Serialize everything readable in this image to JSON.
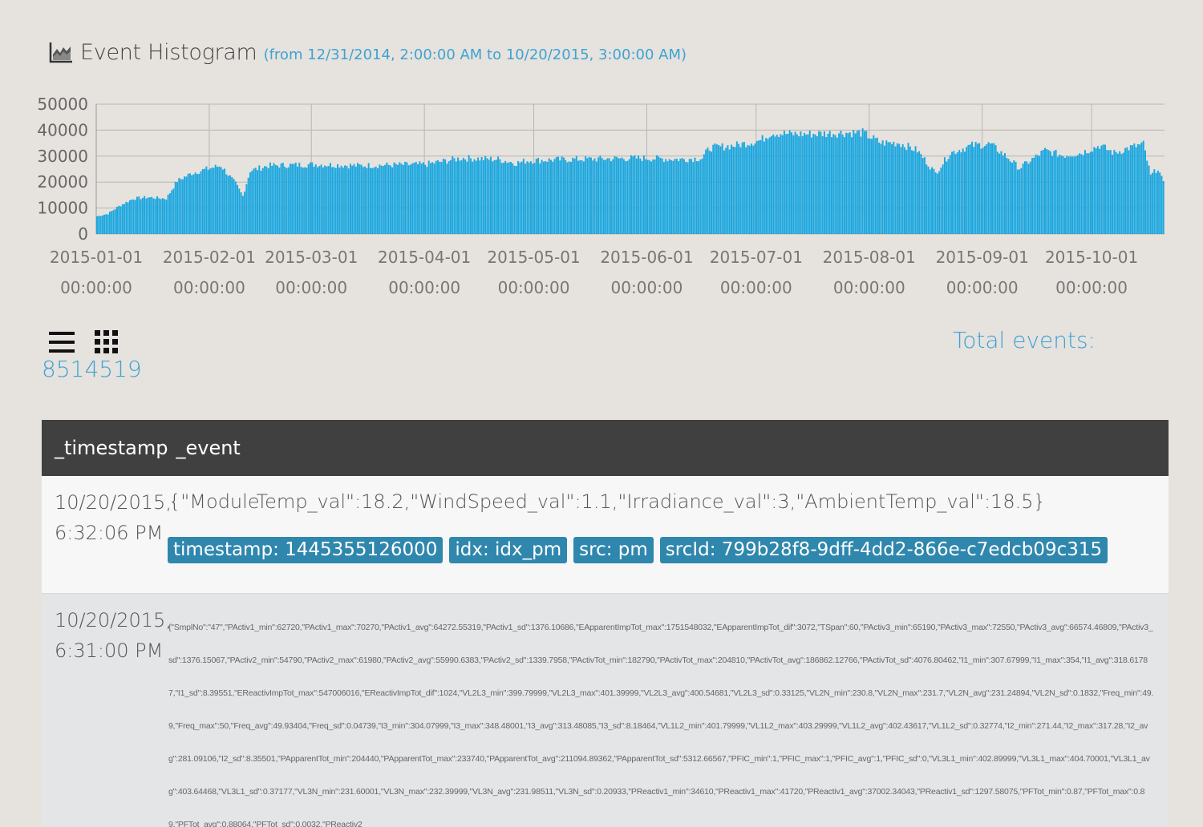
{
  "header": {
    "title": "Event Histogram",
    "range": "(from 12/31/2014, 2:00:00 AM to 10/20/2015, 3:00:00 AM)"
  },
  "chart_data": {
    "type": "bar",
    "color": "#1ba7df",
    "ylim": [
      0,
      50000
    ],
    "y_ticks": [
      "50000",
      "40000",
      "30000",
      "20000",
      "10000",
      "0"
    ],
    "x_ticks": [
      {
        "date": "2015-01-01",
        "time": "00:00:00",
        "day": 0
      },
      {
        "date": "2015-02-01",
        "time": "00:00:00",
        "day": 31
      },
      {
        "date": "2015-03-01",
        "time": "00:00:00",
        "day": 59
      },
      {
        "date": "2015-04-01",
        "time": "00:00:00",
        "day": 90
      },
      {
        "date": "2015-05-01",
        "time": "00:00:00",
        "day": 120
      },
      {
        "date": "2015-06-01",
        "time": "00:00:00",
        "day": 151
      },
      {
        "date": "2015-07-01",
        "time": "00:00:00",
        "day": 181
      },
      {
        "date": "2015-08-01",
        "time": "00:00:00",
        "day": 212
      },
      {
        "date": "2015-09-01",
        "time": "00:00:00",
        "day": 243
      },
      {
        "date": "2015-10-01",
        "time": "00:00:00",
        "day": 273
      }
    ],
    "x_domain_days": [
      0,
      293
    ],
    "profile": [
      [
        0,
        7000
      ],
      [
        3,
        8000
      ],
      [
        6,
        11000
      ],
      [
        10,
        14000
      ],
      [
        14,
        14500
      ],
      [
        19,
        14000
      ],
      [
        22,
        21000
      ],
      [
        26,
        24000
      ],
      [
        31,
        26000
      ],
      [
        34,
        27000
      ],
      [
        38,
        20000
      ],
      [
        40,
        15000
      ],
      [
        42,
        25000
      ],
      [
        47,
        27000
      ],
      [
        60,
        27500
      ],
      [
        72,
        27000
      ],
      [
        90,
        27500
      ],
      [
        100,
        30000
      ],
      [
        110,
        29500
      ],
      [
        115,
        28000
      ],
      [
        118,
        29000
      ],
      [
        130,
        29500
      ],
      [
        150,
        30000
      ],
      [
        160,
        29500
      ],
      [
        166,
        30000
      ],
      [
        168,
        34000
      ],
      [
        175,
        35000
      ],
      [
        182,
        37000
      ],
      [
        185,
        40000
      ],
      [
        190,
        39500
      ],
      [
        195,
        39500
      ],
      [
        205,
        40000
      ],
      [
        210,
        40000
      ],
      [
        215,
        36000
      ],
      [
        220,
        36000
      ],
      [
        225,
        33000
      ],
      [
        230,
        24000
      ],
      [
        234,
        32000
      ],
      [
        240,
        35000
      ],
      [
        245,
        35500
      ],
      [
        250,
        30000
      ],
      [
        253,
        26000
      ],
      [
        256,
        29000
      ],
      [
        260,
        33000
      ],
      [
        265,
        31000
      ],
      [
        270,
        32000
      ],
      [
        275,
        35000
      ],
      [
        279,
        32000
      ],
      [
        283,
        34000
      ],
      [
        287,
        35500
      ],
      [
        289,
        23000
      ],
      [
        291,
        26000
      ],
      [
        293,
        18000
      ]
    ]
  },
  "view": {
    "list_icon": "list-icon",
    "grid_icon": "grid-icon",
    "total_label": "Total events:",
    "total_count": "8514519"
  },
  "table": {
    "columns": [
      "_timestamp",
      "_event"
    ],
    "rows": [
      {
        "timestamp": "10/20/2015, 6:32:06 PM",
        "event": "{\"ModuleTemp_val\":18.2,\"WindSpeed_val\":1.1,\"Irradiance_val\":3,\"AmbientTemp_val\":18.5}",
        "tags": [
          "timestamp: 1445355126000",
          "idx: idx_pm",
          "src: pm",
          "srcId: 799b28f8-9dff-4dd2-866e-c7edcb09c315"
        ]
      },
      {
        "timestamp": "10/20/2015, 6:31:00 PM",
        "event": "{\"SmplNo\":\"47\",\"PActiv1_min\":62720,\"PActiv1_max\":70270,\"PActiv1_avg\":64272.55319,\"PActiv1_sd\":1376.10686,\"EApparentImpTot_max\":1751548032,\"EApparentImpTot_dif\":3072,\"TSpan\":60,\"PActiv3_min\":65190,\"PActiv3_max\":72550,\"PActiv3_avg\":66574.46809,\"PActiv3_sd\":1376.15067,\"PActiv2_min\":54790,\"PActiv2_max\":61980,\"PActiv2_avg\":55990.6383,\"PActiv2_sd\":1339.7958,\"PActivTot_min\":182790,\"PActivTot_max\":204810,\"PActivTot_avg\":186862.12766,\"PActivTot_sd\":4076.80462,\"I1_min\":307.67999,\"I1_max\":354,\"I1_avg\":318.61787,\"I1_sd\":8.39551,\"EReactivImpTot_max\":547006016,\"EReactivImpTot_dif\":1024,\"VL2L3_min\":399.79999,\"VL2L3_max\":401.39999,\"VL2L3_avg\":400.54681,\"VL2L3_sd\":0.33125,\"VL2N_min\":230.8,\"VL2N_max\":231.7,\"VL2N_avg\":231.24894,\"VL2N_sd\":0.1832,\"Freq_min\":49.9,\"Freq_max\":50,\"Freq_avg\":49.93404,\"Freq_sd\":0.04739,\"I3_min\":304.07999,\"I3_max\":348.48001,\"I3_avg\":313.48085,\"I3_sd\":8.18464,\"VL1L2_min\":401.79999,\"VL1L2_max\":403.29999,\"VL1L2_avg\":402.43617,\"VL1L2_sd\":0.32774,\"I2_min\":271.44,\"I2_max\":317.28,\"I2_avg\":281.09106,\"I2_sd\":8.35501,\"PApparentTot_min\":204440,\"PApparentTot_max\":233740,\"PApparentTot_avg\":211094.89362,\"PApparentTot_sd\":5312.66567,\"PFIC_min\":1,\"PFIC_max\":1,\"PFIC_avg\":1,\"PFIC_sd\":0,\"VL3L1_min\":402.89999,\"VL3L1_max\":404.70001,\"VL3L1_avg\":403.64468,\"VL3L1_sd\":0.37177,\"VL3N_min\":231.60001,\"VL3N_max\":232.39999,\"VL3N_avg\":231.98511,\"VL3N_sd\":0.20933,\"PReactiv1_min\":34610,\"PReactiv1_max\":41720,\"PReactiv1_avg\":37002.34043,\"PReactiv1_sd\":1297.58075,\"PFTot_min\":0.87,\"PFTot_max\":0.89,\"PFTot_avg\":0.88064,\"PFTot_sd\":0.0032,\"PReactiv2"
      }
    ]
  }
}
